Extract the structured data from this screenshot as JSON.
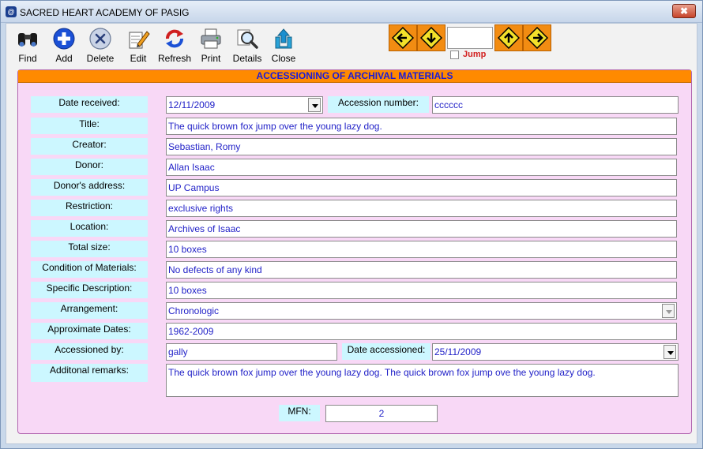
{
  "window": {
    "title": "SACRED HEART ACADEMY OF PASIG",
    "close_glyph": "✖"
  },
  "toolbar": {
    "items": [
      {
        "label": "Find",
        "icon": "binoculars-icon"
      },
      {
        "label": "Add",
        "icon": "plus-circle-icon"
      },
      {
        "label": "Delete",
        "icon": "x-circle-icon"
      },
      {
        "label": "Edit",
        "icon": "edit-pencil-icon"
      },
      {
        "label": "Refresh",
        "icon": "refresh-icon"
      },
      {
        "label": "Print",
        "icon": "printer-icon"
      },
      {
        "label": "Details",
        "icon": "magnifier-icon"
      },
      {
        "label": "Close",
        "icon": "exit-icon"
      }
    ]
  },
  "navigation": {
    "jump_label": "Jump",
    "jump_value": ""
  },
  "panel": {
    "title": "ACCESSIONING OF ARCHIVAL MATERIALS"
  },
  "form": {
    "date_received": {
      "label": "Date received:",
      "value": "12/11/2009"
    },
    "accession_number": {
      "label": "Accession number:",
      "value": "cccccc"
    },
    "title": {
      "label": "Title:",
      "value": "The quick brown fox jump over the young lazy dog."
    },
    "creator": {
      "label": "Creator:",
      "value": "Sebastian, Romy"
    },
    "donor": {
      "label": "Donor:",
      "value": "Allan Isaac"
    },
    "donor_address": {
      "label": "Donor's address:",
      "value": "UP Campus"
    },
    "restriction": {
      "label": "Restriction:",
      "value": "exclusive rights"
    },
    "location": {
      "label": "Location:",
      "value": "Archives of Isaac"
    },
    "total_size": {
      "label": "Total size:",
      "value": "10 boxes"
    },
    "condition": {
      "label": "Condition of Materials:",
      "value": "No defects of any kind"
    },
    "specific_description": {
      "label": "Specific Description:",
      "value": "10 boxes"
    },
    "arrangement": {
      "label": "Arrangement:",
      "value": "Chronologic"
    },
    "approximate_dates": {
      "label": "Approximate Dates:",
      "value": "1962-2009"
    },
    "accessioned_by": {
      "label": "Accessioned by:",
      "value": "gally"
    },
    "date_accessioned": {
      "label": "Date accessioned:",
      "value": "25/11/2009"
    },
    "remarks": {
      "label": "Additonal remarks:",
      "value": "The quick brown fox jump over the young lazy dog.  The quick brown fox jump ove the young lazy dog."
    },
    "mfn": {
      "label": "MFN:",
      "value": "2"
    }
  },
  "colors": {
    "panel_bg": "#f8d8f6",
    "header_bg": "#ff8a00",
    "header_text": "#1b1bd8",
    "label_bg": "#ccf7ff",
    "value_text": "#2222c8",
    "jump_text": "#d21f1f"
  }
}
